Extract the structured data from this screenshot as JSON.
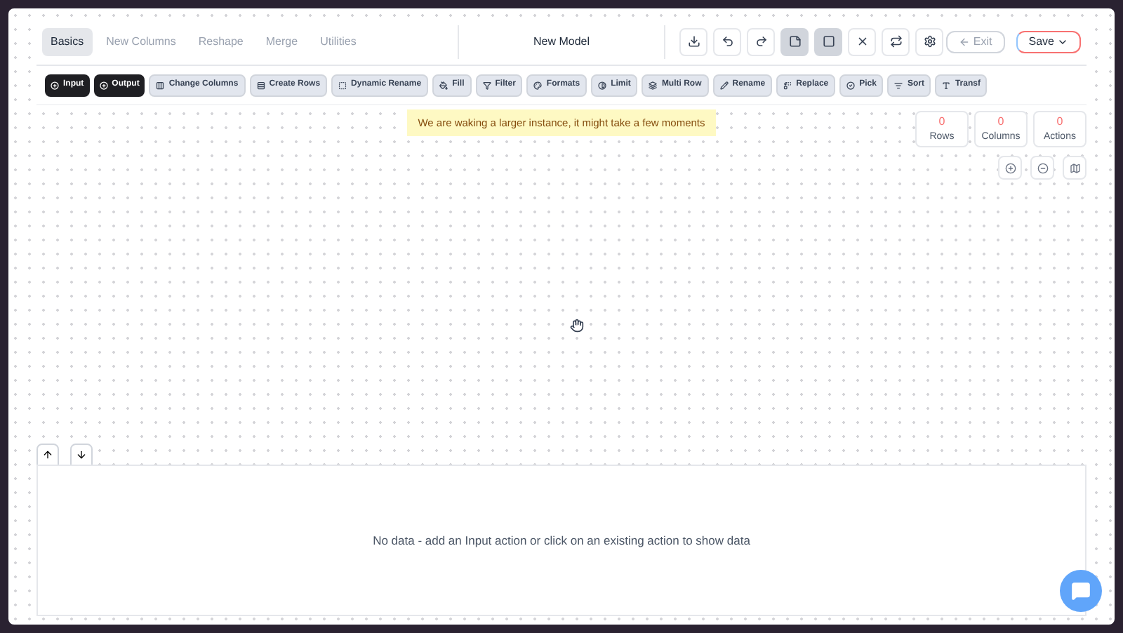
{
  "tabs": [
    {
      "label": "Basics",
      "selected": true
    },
    {
      "label": "New Columns",
      "selected": false
    },
    {
      "label": "Reshape",
      "selected": false
    },
    {
      "label": "Merge",
      "selected": false
    },
    {
      "label": "Utilities",
      "selected": false
    }
  ],
  "title": "New Model",
  "header_tools": [
    {
      "selected": false
    },
    {
      "selected": false
    },
    {
      "selected": false
    },
    {
      "selected": true
    },
    {
      "selected": true
    },
    {
      "selected": false
    },
    {
      "selected": false
    },
    {
      "selected": false
    }
  ],
  "exit_button": "Exit",
  "save_button": "Save",
  "actions": [
    {
      "label": "Input",
      "kind": "primary"
    },
    {
      "label": "Output",
      "kind": "primary"
    },
    {
      "label": "Change Columns",
      "kind": "secondary"
    },
    {
      "label": "Create Rows",
      "kind": "secondary"
    },
    {
      "label": "Dynamic Rename",
      "kind": "secondary"
    },
    {
      "label": "Fill",
      "kind": "secondary"
    },
    {
      "label": "Filter",
      "kind": "secondary"
    },
    {
      "label": "Formats",
      "kind": "secondary"
    },
    {
      "label": "Limit",
      "kind": "secondary"
    },
    {
      "label": "Multi Row",
      "kind": "secondary"
    },
    {
      "label": "Rename",
      "kind": "secondary"
    },
    {
      "label": "Replace",
      "kind": "secondary"
    },
    {
      "label": "Pick",
      "kind": "secondary"
    },
    {
      "label": "Sort",
      "kind": "secondary"
    },
    {
      "label": "Transf",
      "kind": "secondary"
    }
  ],
  "notice": "We are waking a larger instance, it might take a few moments",
  "stats": [
    {
      "value": "0",
      "label": "Rows"
    },
    {
      "value": "0",
      "label": "Columns"
    },
    {
      "value": "0",
      "label": "Actions"
    }
  ],
  "empty_message": "No data - add an Input action or click on an existing action to show data"
}
